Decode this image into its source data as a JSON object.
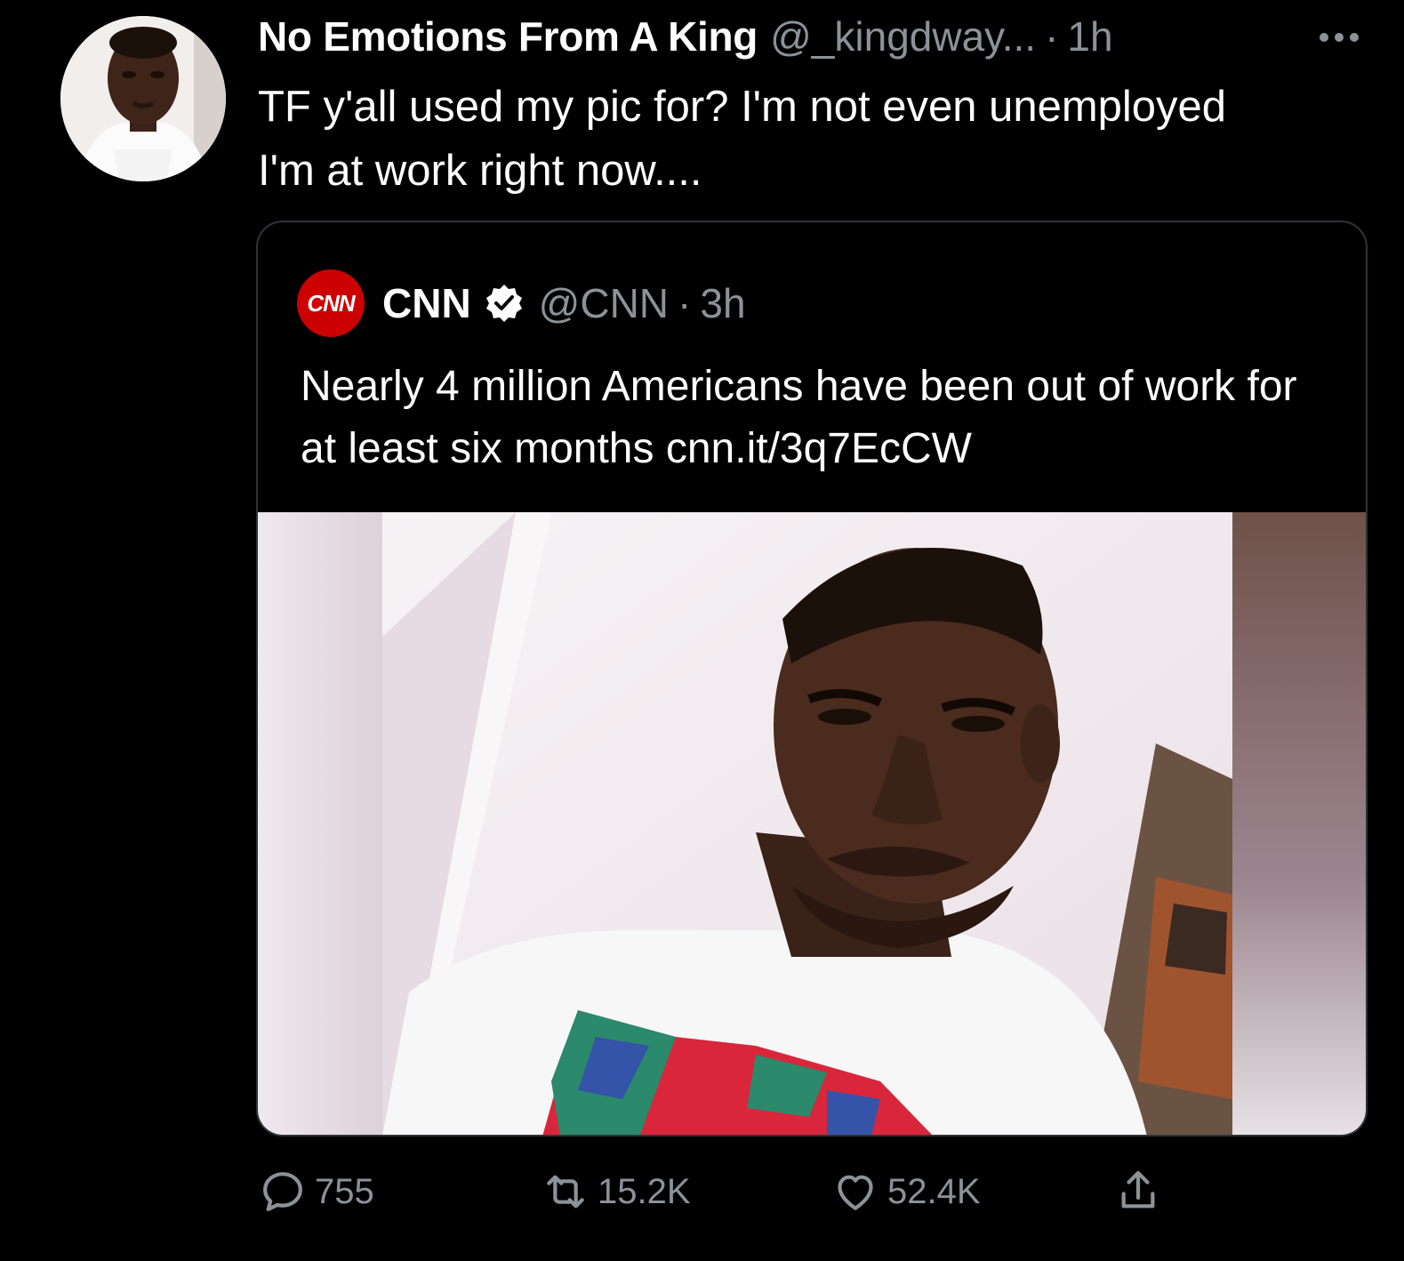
{
  "tweet": {
    "display_name": "No Emotions From A King",
    "handle": "@_kingdway...",
    "separator": "·",
    "time": "1h",
    "text": "TF y'all used my pic for? I'm not even unemployed I'm at work right now....",
    "avatar_icon": "user-avatar-photo",
    "more_icon": "more-dots-icon"
  },
  "quote": {
    "logo_text": "CNN",
    "name": "CNN",
    "handle": "@CNN",
    "separator": "·",
    "time": "3h",
    "verified_icon": "verified-badge-icon",
    "text": "Nearly 4 million Americans have been out of work for at least six months cnn.it/3q7EcCW",
    "image_icon": "man-selfie-photo"
  },
  "actions": {
    "reply_count": "755",
    "retweet_count": "15.2K",
    "like_count": "52.4K",
    "reply_icon": "reply-icon",
    "retweet_icon": "retweet-icon",
    "like_icon": "heart-icon",
    "share_icon": "share-icon"
  },
  "colors": {
    "background": "#000000",
    "text": "#ffffff",
    "muted": "#8b9299",
    "cnn_red": "#cc0000",
    "border": "#2f3336"
  }
}
